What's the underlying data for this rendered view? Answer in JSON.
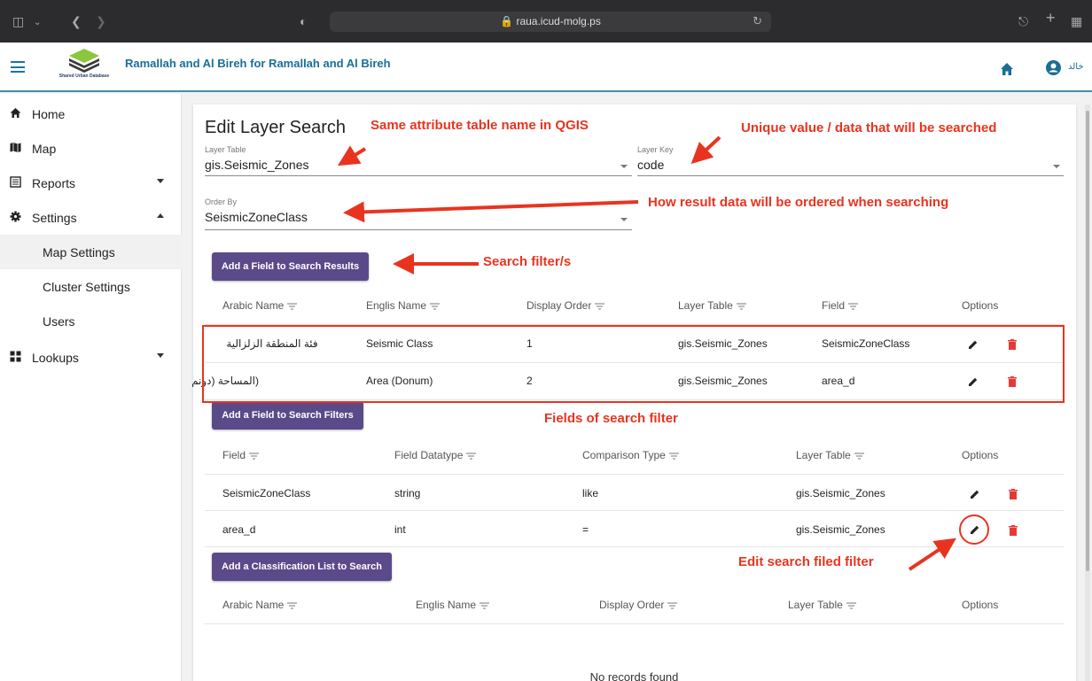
{
  "browser": {
    "url": "raua.icud-molg.ps"
  },
  "header": {
    "title": "Ramallah and Al Bireh for Ramallah and Al Bireh",
    "logo_text": "Shared Urban Database",
    "user_name": "خالد"
  },
  "sidebar": {
    "items": [
      {
        "label": "Home",
        "icon": "home-icon"
      },
      {
        "label": "Map",
        "icon": "map-icon"
      },
      {
        "label": "Reports",
        "icon": "reports-icon"
      },
      {
        "label": "Settings",
        "icon": "gear-icon"
      },
      {
        "label": "Map Settings"
      },
      {
        "label": "Cluster Settings"
      },
      {
        "label": "Users"
      },
      {
        "label": "Lookups",
        "icon": "lookups-icon"
      }
    ]
  },
  "form": {
    "title": "Edit Layer Search",
    "layer_table_label": "Layer Table",
    "layer_table_value": "gis.Seismic_Zones",
    "layer_key_label": "Layer Key",
    "layer_key_value": "code",
    "order_by_label": "Order By",
    "order_by_value": "SeismicZoneClass"
  },
  "results": {
    "button": "Add a Field to Search Results",
    "headers": [
      "Arabic Name",
      "Englis Name",
      "Display Order",
      "Layer Table",
      "Field",
      "Options"
    ],
    "rows": [
      [
        "فئة المنطقة الزلزالية",
        "Seismic Class",
        "1",
        "gis.Seismic_Zones",
        "SeismicZoneClass"
      ],
      [
        "(المساحة (دونم",
        "Area (Donum)",
        "2",
        "gis.Seismic_Zones",
        "area_d"
      ]
    ]
  },
  "filters": {
    "button": "Add a Field to Search Filters",
    "headers": [
      "Field",
      "Field Datatype",
      "Comparison Type",
      "Layer Table",
      "Options"
    ],
    "rows": [
      [
        "SeismicZoneClass",
        "string",
        "like",
        "gis.Seismic_Zones"
      ],
      [
        "area_d",
        "int",
        "=",
        "gis.Seismic_Zones"
      ]
    ]
  },
  "classification": {
    "button": "Add a Classification List to Search",
    "headers": [
      "Arabic Name",
      "Englis Name",
      "Display Order",
      "Layer Table",
      "Options"
    ],
    "empty_text": "No records found"
  },
  "annotations": {
    "a1": "Same attribute table name in QGIS",
    "a2": "Unique value / data that will be searched",
    "a3": "How result data will be ordered when searching",
    "a4": "Search filter/s",
    "a5": "Fields of search filter",
    "a6": "Edit search filed filter"
  },
  "colors": {
    "accent": "#5b4a8a",
    "annotation": "#e8341f",
    "header_title": "#1a6e96",
    "delete": "#e53935"
  }
}
